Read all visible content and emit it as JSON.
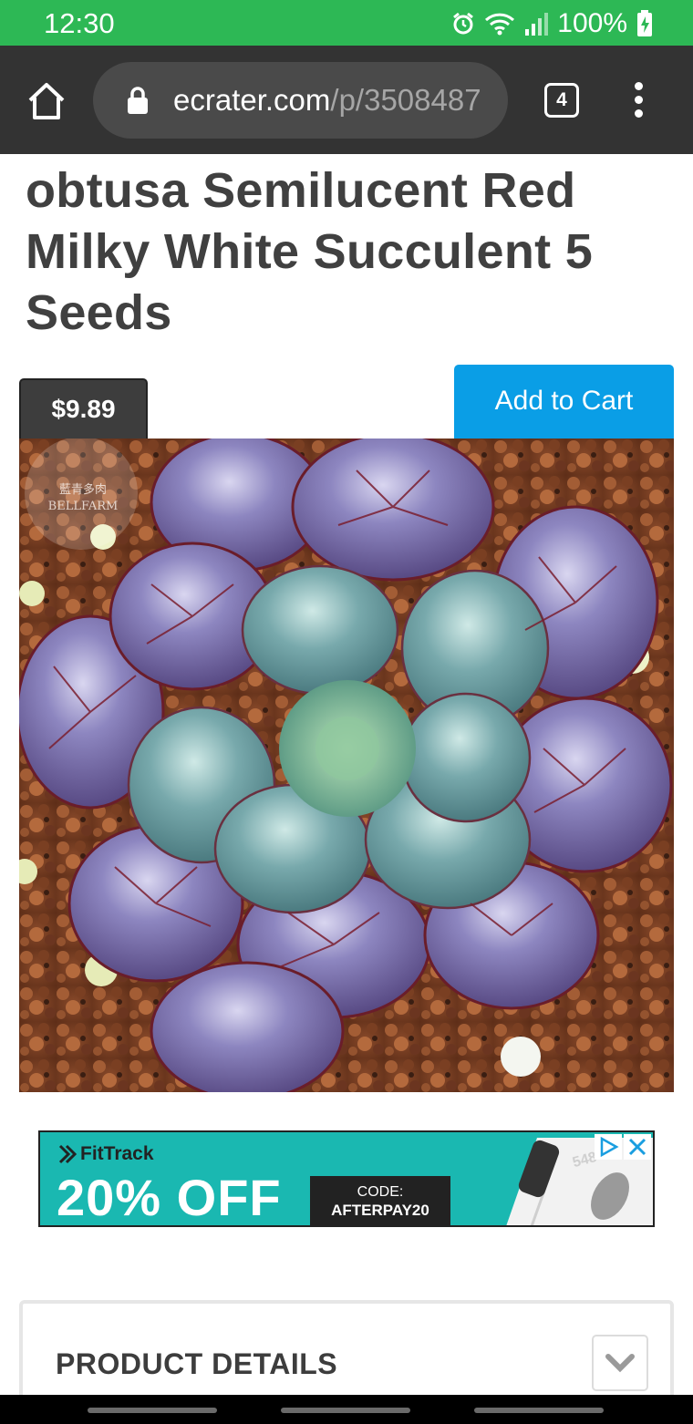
{
  "status_bar": {
    "time": "12:30",
    "battery": "100%",
    "icons": [
      "alarm-icon",
      "wifi-icon",
      "signal-icon",
      "battery-charging-icon"
    ]
  },
  "browser": {
    "url_domain": "ecrater.com",
    "url_path": "/p/3508487",
    "tab_count": "4",
    "icons": [
      "home-icon",
      "lock-icon",
      "tabs-icon",
      "more-menu-icon"
    ]
  },
  "product": {
    "title": "obtusa Semilucent Red Milky White Succulent 5 Seeds",
    "price": "$9.89",
    "add_to_cart_label": "Add to Cart",
    "watermark": "藍青多肉 BELLFARM"
  },
  "ad": {
    "brand": "FitTrack",
    "headline": "20% OFF",
    "code_label": "CODE:",
    "code_value": "AFTERPAY20",
    "scale_reading": "548"
  },
  "details": {
    "title": "PRODUCT DETAILS"
  },
  "colors": {
    "status_bar": "#2db855",
    "toolbar": "#333333",
    "cart_button": "#0a9ee6",
    "price_badge": "#3d3d3d",
    "ad_background": "#1ab8b1"
  }
}
